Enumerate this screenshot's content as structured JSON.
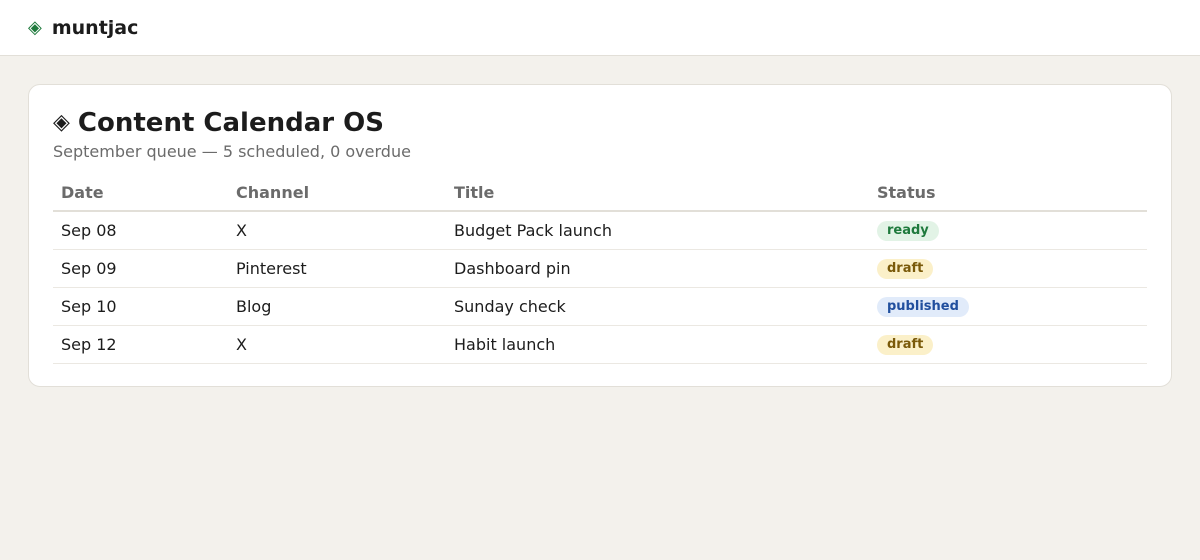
{
  "header": {
    "brand_icon": "diamond-icon",
    "brand_name": "muntjac"
  },
  "page": {
    "title_icon": "diamond-icon",
    "title": "Content Calendar OS",
    "subtitle": "September queue — 5 scheduled, 0 overdue"
  },
  "table": {
    "columns": [
      "Date",
      "Channel",
      "Title",
      "Status"
    ],
    "rows": [
      {
        "date": "Sep 08",
        "channel": "X",
        "title": "Budget Pack launch",
        "status": "ready"
      },
      {
        "date": "Sep 09",
        "channel": "Pinterest",
        "title": "Dashboard pin",
        "status": "draft"
      },
      {
        "date": "Sep 10",
        "channel": "Blog",
        "title": "Sunday check",
        "status": "published"
      },
      {
        "date": "Sep 12",
        "channel": "X",
        "title": "Habit launch",
        "status": "draft"
      }
    ]
  },
  "colors": {
    "brand_accent": "#1f7a3d",
    "ready": "#1f7a3d",
    "draft": "#7a5a0a",
    "published": "#214f9e",
    "background": "#f3f1ec"
  }
}
